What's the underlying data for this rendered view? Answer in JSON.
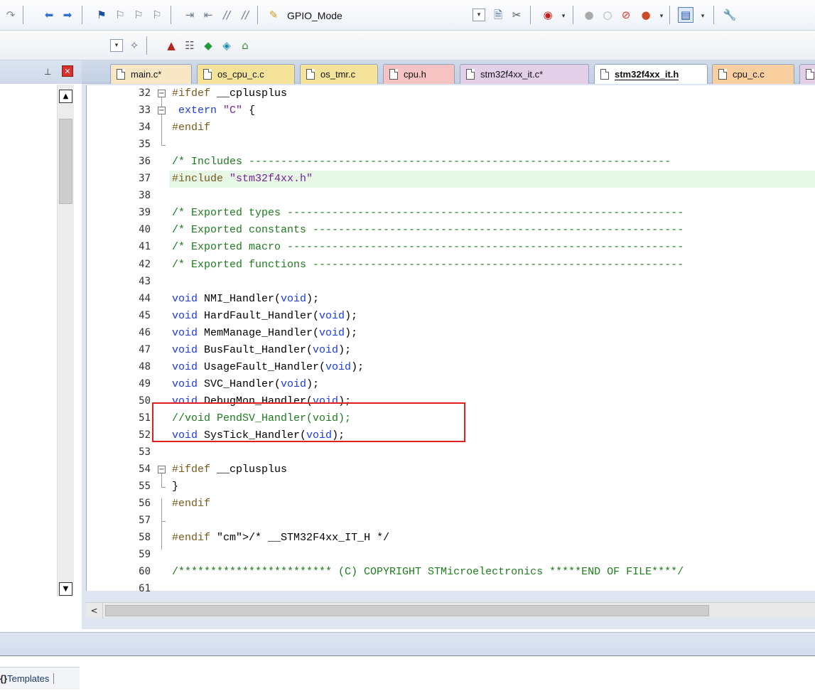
{
  "toolbar": {
    "target_combo": "GPIO_Mode"
  },
  "left_panel": {
    "bottom_tab": "Templates"
  },
  "tabs": [
    {
      "label": "main.c*",
      "color": "#f7e7c4"
    },
    {
      "label": "os_cpu_c.c",
      "color": "#f6e39a"
    },
    {
      "label": "os_tmr.c",
      "color": "#f6e39a"
    },
    {
      "label": "cpu.h",
      "color": "#f7c2c2"
    },
    {
      "label": "stm32f4xx_it.c*",
      "color": "#e4cfe9"
    },
    {
      "label": "stm32f4xx_it.h",
      "color": "#ffffff",
      "active": true
    },
    {
      "label": "cpu_c.c",
      "color": "#f9cfa0"
    }
  ],
  "code_lines": [
    {
      "n": "32",
      "text": "#ifdef __cplusplus"
    },
    {
      "n": "33",
      "text": " extern \"C\" {"
    },
    {
      "n": "34",
      "text": "#endif"
    },
    {
      "n": "35",
      "text": ""
    },
    {
      "n": "36",
      "text": "/* Includes ------------------------------------------------------------------"
    },
    {
      "n": "37",
      "text": "#include \"stm32f4xx.h\""
    },
    {
      "n": "38",
      "text": ""
    },
    {
      "n": "39",
      "text": "/* Exported types --------------------------------------------------------------"
    },
    {
      "n": "40",
      "text": "/* Exported constants ----------------------------------------------------------"
    },
    {
      "n": "41",
      "text": "/* Exported macro --------------------------------------------------------------"
    },
    {
      "n": "42",
      "text": "/* Exported functions ----------------------------------------------------------"
    },
    {
      "n": "43",
      "text": ""
    },
    {
      "n": "44",
      "text": "void NMI_Handler(void);"
    },
    {
      "n": "45",
      "text": "void HardFault_Handler(void);"
    },
    {
      "n": "46",
      "text": "void MemManage_Handler(void);"
    },
    {
      "n": "47",
      "text": "void BusFault_Handler(void);"
    },
    {
      "n": "48",
      "text": "void UsageFault_Handler(void);"
    },
    {
      "n": "49",
      "text": "void SVC_Handler(void);"
    },
    {
      "n": "50",
      "text": "void DebugMon_Handler(void);"
    },
    {
      "n": "51",
      "text": "//void PendSV_Handler(void);"
    },
    {
      "n": "52",
      "text": "void SysTick_Handler(void);"
    },
    {
      "n": "53",
      "text": ""
    },
    {
      "n": "54",
      "text": "#ifdef __cplusplus"
    },
    {
      "n": "55",
      "text": "}"
    },
    {
      "n": "56",
      "text": "#endif"
    },
    {
      "n": "57",
      "text": ""
    },
    {
      "n": "58",
      "text": "#endif /* __STM32F4xx_IT_H */"
    },
    {
      "n": "59",
      "text": ""
    },
    {
      "n": "60",
      "text": "/************************ (C) COPYRIGHT STMicroelectronics *****END OF FILE****/"
    },
    {
      "n": "61",
      "text": ""
    }
  ],
  "colors": {
    "keyword": "#1b3cd8",
    "comment": "#1e7b1e",
    "preprocessor": "#7a5a1a",
    "string": "#7a1f9f",
    "highlight_line": "#e6f7e6",
    "annotation_box": "#e02020"
  }
}
